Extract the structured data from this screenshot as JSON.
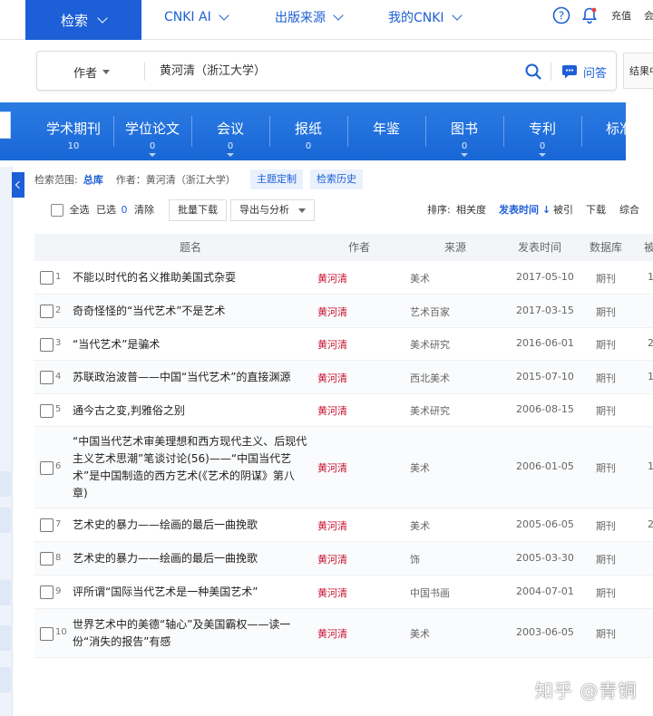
{
  "nav": {
    "search_tab": "检索",
    "items": [
      "CNKI AI",
      "出版来源",
      "我的CNKI"
    ],
    "recharge": "充值",
    "more": "会"
  },
  "search": {
    "field": "作者",
    "query": "黄河清（浙江大学）",
    "qa_label": "问答",
    "results_btn": "结果中"
  },
  "categories": [
    {
      "label": "学术期刊",
      "count": "10"
    },
    {
      "label": "学位论文",
      "count": "0"
    },
    {
      "label": "会议",
      "count": "0"
    },
    {
      "label": "报纸",
      "count": "0"
    },
    {
      "label": "年鉴",
      "count": ""
    },
    {
      "label": "图书",
      "count": "0"
    },
    {
      "label": "专利",
      "count": "0"
    },
    {
      "label": "标准",
      "count": ""
    }
  ],
  "scope": {
    "prefix": "检索范围:",
    "library": "总库",
    "author_filter": "作者：黄河清（浙江大学）",
    "theme_btn": "主题定制",
    "history_btn": "检索历史"
  },
  "toolbar": {
    "select_all": "全选",
    "selected": "已选",
    "selected_count": "0",
    "clear": "清除",
    "batch_download": "批量下载",
    "export": "导出与分析",
    "sort_label": "排序:",
    "sort_relevance": "相关度",
    "sort_date": "发表时间",
    "sort_cited": "被引",
    "sort_downloads": "下载",
    "sort_overall": "综合"
  },
  "table": {
    "headers": {
      "title": "题名",
      "author": "作者",
      "source": "来源",
      "date": "发表时间",
      "db": "数据库",
      "cited": "被"
    },
    "rows": [
      {
        "num": "1",
        "title": "不能以时代的名义推助美国式杂耍",
        "author": "黄河清",
        "source": "美术",
        "date": "2017-05-10",
        "db": "期刊",
        "cited": "1"
      },
      {
        "num": "2",
        "title": "奇奇怪怪的“当代艺术”不是艺术",
        "author": "黄河清",
        "source": "艺术百家",
        "date": "2017-03-15",
        "db": "期刊",
        "cited": ""
      },
      {
        "num": "3",
        "title": "“当代艺术”是骗术",
        "author": "黄河清",
        "source": "美术研究",
        "date": "2016-06-01",
        "db": "期刊",
        "cited": "2"
      },
      {
        "num": "4",
        "title": "苏联政治波普——中国“当代艺术”的直接渊源",
        "author": "黄河清",
        "source": "西北美术",
        "date": "2015-07-10",
        "db": "期刊",
        "cited": "1"
      },
      {
        "num": "5",
        "title": "通今古之变,判雅俗之别",
        "author": "黄河清",
        "source": "美术研究",
        "date": "2006-08-15",
        "db": "期刊",
        "cited": ""
      },
      {
        "num": "6",
        "title": "“中国当代艺术审美理想和西方现代主义、后现代主义艺术思潮”笔谈讨论(56)——“中国当代艺术”是中国制造的西方艺术(《艺术的阴谋》第八章)",
        "author": "黄河清",
        "source": "美术",
        "date": "2006-01-05",
        "db": "期刊",
        "cited": "1"
      },
      {
        "num": "7",
        "title": "艺术史的暴力——绘画的最后一曲挽歌",
        "author": "黄河清",
        "source": "美术",
        "date": "2005-06-05",
        "db": "期刊",
        "cited": "2"
      },
      {
        "num": "8",
        "title": "艺术史的暴力——绘画的最后一曲挽歌",
        "author": "黄河清",
        "source": "饰",
        "date": "2005-03-30",
        "db": "期刊",
        "cited": ""
      },
      {
        "num": "9",
        "title": "评所谓“国际当代艺术是一种美国艺术”",
        "author": "黄河清",
        "source": "中国书画",
        "date": "2004-07-01",
        "db": "期刊",
        "cited": ""
      },
      {
        "num": "10",
        "title": "世界艺术中的美德“轴心”及美国霸权——读一份“消失的报告”有感",
        "author": "黄河清",
        "source": "美术",
        "date": "2003-06-05",
        "db": "期刊",
        "cited": ""
      }
    ]
  },
  "watermark": "知乎 @青铜"
}
